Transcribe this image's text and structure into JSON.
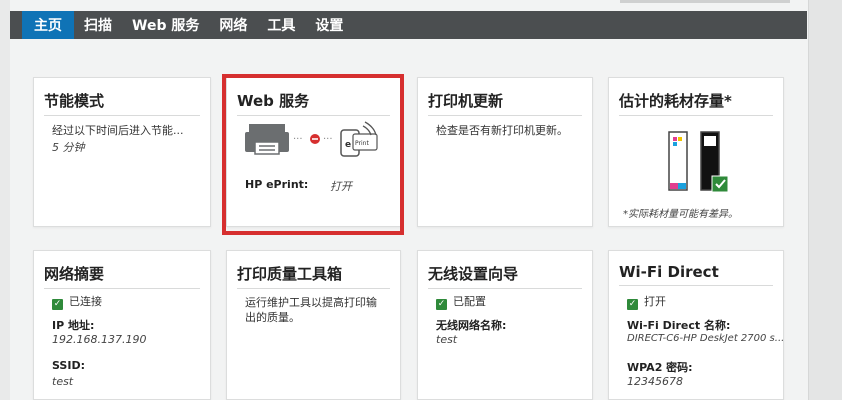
{
  "nav": {
    "items": [
      "主页",
      "扫描",
      "Web 服务",
      "网络",
      "工具",
      "设置"
    ]
  },
  "cards": {
    "energy": {
      "title": "节能模式",
      "line1": "经过以下时间后进入节能...",
      "line2": "5 分钟"
    },
    "web": {
      "title": "Web 服务",
      "eprint_label": "HP ePrint:",
      "eprint_value": "打开"
    },
    "update": {
      "title": "打印机更新",
      "text": "检查是否有新打印机更新。"
    },
    "supplies": {
      "title": "估计的耗材存量*",
      "note": "*实际耗材量可能有差异。"
    },
    "network": {
      "title": "网络摘要",
      "status": "已连接",
      "ip_label": "IP 地址:",
      "ip_value": "192.168.137.190",
      "ssid_label": "SSID:",
      "ssid_value": "test"
    },
    "quality": {
      "title": "打印质量工具箱",
      "line1": "运行维护工具以提高打印输",
      "line2": "出的质量。"
    },
    "wireless": {
      "title": "无线设置向导",
      "status": "已配置",
      "name_label": "无线网络名称:",
      "name_value": "test"
    },
    "wifidirect": {
      "title": "Wi-Fi Direct",
      "status": "打开",
      "name_label": "Wi-Fi Direct 名称:",
      "name_value": "DIRECT-C6-HP DeskJet 2700 s...",
      "wpa_label": "WPA2 密码:",
      "wpa_value": "12345678"
    }
  },
  "colors": {
    "nav_bg": "#4b4e50",
    "active_tab": "#0f73b6",
    "highlight": "#d62f2f",
    "check": "#2f8a3a"
  }
}
